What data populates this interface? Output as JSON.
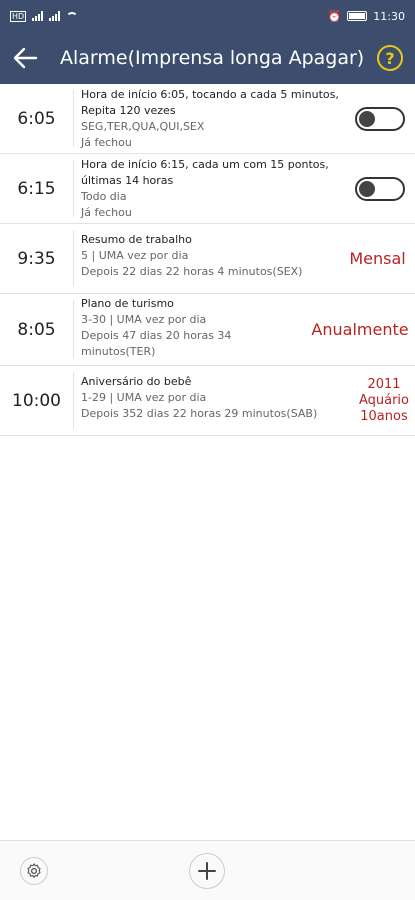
{
  "status_bar": {
    "time": "11:30",
    "battery": "100"
  },
  "header": {
    "title": "Alarme(Imprensa longa Apagar)",
    "help_label": "?"
  },
  "alarms": [
    {
      "time": "6:05",
      "line1": "Hora de início 6:05, tocando a cada 5 minutos,",
      "line2": "Repita 120 vezes",
      "line3": "SEG,TER,QUA,QUI,SEX",
      "line4": "Já fechou",
      "enabled": false
    },
    {
      "time": "6:15",
      "line1": "Hora de início 6:15, cada um com 15 pontos,",
      "line2": "últimas 14 horas",
      "line3": "Todo dia",
      "line4": "Já fechou",
      "enabled": false
    },
    {
      "time": "9:35",
      "line1": "Resumo de trabalho",
      "line2": "5 | UMA vez por dia",
      "line3": "Depois 22 dias 22 horas 4 minutos(SEX)",
      "badge": "Mensal"
    },
    {
      "time": "8:05",
      "line1": "Plano de turismo",
      "line2": "3-30 | UMA vez por dia",
      "line3": "Depois 47 dias 20 horas 34",
      "line4": "minutos(TER)",
      "badge": "Anualmente"
    },
    {
      "time": "10:00",
      "line1": "Aniversário do bebê",
      "line2": "1-29 | UMA vez por dia",
      "line3": "Depois 352 dias 22 horas 29 minutos(SAB)",
      "badge_lines": [
        "2011",
        "Aquário",
        "10anos"
      ]
    }
  ],
  "colors": {
    "header_bg": "#3d4d6e",
    "accent_red": "#b52425",
    "help_yellow": "#e8c817"
  },
  "icons": {
    "back": "arrow-left-icon",
    "help": "question-circle-icon",
    "settings": "gear-icon",
    "add": "plus-icon"
  }
}
